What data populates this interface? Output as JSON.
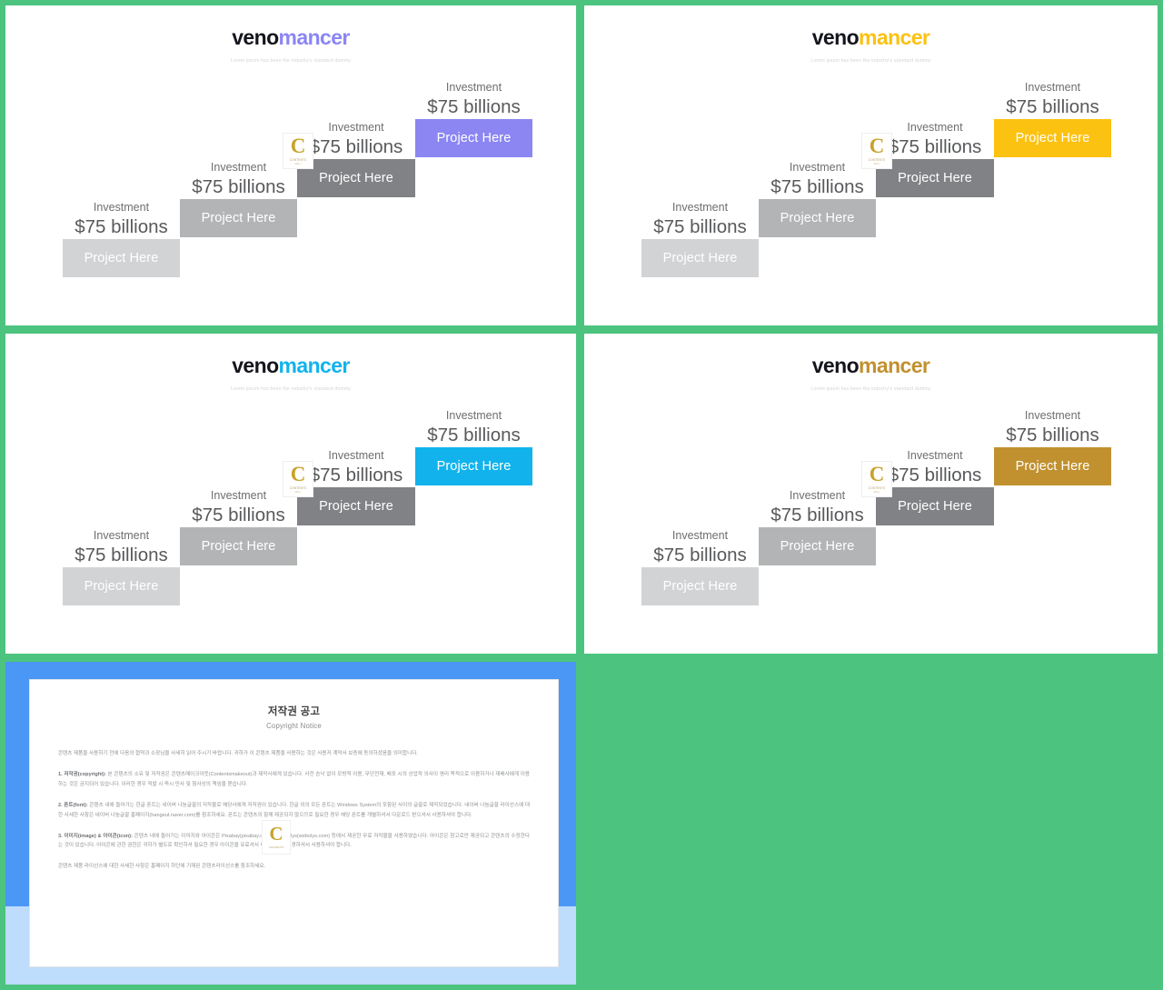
{
  "brand": {
    "name_part_a": "veno",
    "name_part_b": "mancer",
    "tagline": "Lorem ipsum has been the industry's standard dummy"
  },
  "watermark": {
    "letter": "C",
    "sub": "CONTENTS",
    "sub2": "MALL"
  },
  "step_defaults": {
    "investment_label": "Investment",
    "investment_value": "$75 billions",
    "bar_label": "Project Here"
  },
  "slides": [
    {
      "id": "slide-1",
      "accent_color": "#8b86f2",
      "logo_accent": "#8b86f2",
      "steps": [
        {
          "label": "Investment",
          "value": "$75 billions",
          "bar": "Project Here",
          "color": "#d2d3d5"
        },
        {
          "label": "Investment",
          "value": "$75 billions",
          "bar": "Project Here",
          "color": "#b3b4b6"
        },
        {
          "label": "Investment",
          "value": "$75 billions",
          "bar": "Project Here",
          "color": "#808285"
        },
        {
          "label": "Investment",
          "value": "$75 billions",
          "bar": "Project Here",
          "color": "#8b86f2"
        }
      ]
    },
    {
      "id": "slide-2",
      "accent_color": "#fcc211",
      "logo_accent": "#fcc211",
      "steps": [
        {
          "label": "Investment",
          "value": "$75 billions",
          "bar": "Project Here",
          "color": "#d2d3d5"
        },
        {
          "label": "Investment",
          "value": "$75 billions",
          "bar": "Project Here",
          "color": "#b3b4b6"
        },
        {
          "label": "Investment",
          "value": "$75 billions",
          "bar": "Project Here",
          "color": "#808285"
        },
        {
          "label": "Investment",
          "value": "$75 billions",
          "bar": "Project Here",
          "color": "#fcc211"
        }
      ]
    },
    {
      "id": "slide-3",
      "accent_color": "#12b3ec",
      "logo_accent": "#12b3ec",
      "steps": [
        {
          "label": "Investment",
          "value": "$75 billions",
          "bar": "Project Here",
          "color": "#d2d3d5"
        },
        {
          "label": "Investment",
          "value": "$75 billions",
          "bar": "Project Here",
          "color": "#b3b4b6"
        },
        {
          "label": "Investment",
          "value": "$75 billions",
          "bar": "Project Here",
          "color": "#808285"
        },
        {
          "label": "Investment",
          "value": "$75 billions",
          "bar": "Project Here",
          "color": "#12b3ec"
        }
      ]
    },
    {
      "id": "slide-4",
      "accent_color": "#c1912f",
      "logo_accent": "#c1912f",
      "steps": [
        {
          "label": "Investment",
          "value": "$75 billions",
          "bar": "Project Here",
          "color": "#d2d3d5"
        },
        {
          "label": "Investment",
          "value": "$75 billions",
          "bar": "Project Here",
          "color": "#b3b4b6"
        },
        {
          "label": "Investment",
          "value": "$75 billions",
          "bar": "Project Here",
          "color": "#808285"
        },
        {
          "label": "Investment",
          "value": "$75 billions",
          "bar": "Project Here",
          "color": "#c1912f"
        }
      ]
    }
  ],
  "copyright_notice": {
    "title": "저작권 공고",
    "subtitle": "Copyright Notice",
    "paragraphs": [
      {
        "lead": "",
        "text": "콘텐츠 제품을 사용하기 전에 다음의 협약과 소장님을 사세히 읽어 주시기 바랍니다. 귀하가 이 콘텐츠 제품을 사용하는 것은 사용자 계약서 보증에 동의하셨음을 의미합니다."
      },
      {
        "lead": "1. 저작권(copyright):",
        "text": " 본 콘텐츠의 소유 및 저작권은 콘텐츠메이크아웃(Contentsmakeout)과 제작사에게 있습니다. 사전 승낙 없이 모방적 이용, 무단전재, 배포 시의 상업적 의사이 영리 목적으로 이용하거나 재배사에게 이용하는 것은 금지되어 있습니다. 이러한 경우 적발 시 즉시 민사 및 형사상의 책임을 묻습니다."
      },
      {
        "lead": "2. 폰트(font):",
        "text": " 콘텐츠 내에 들어가는 한글 폰트는 네이버 나눔글꼴의 저작물로 해당사에게 저작권이 있습니다. 한글 외의 모든 폰트는 Windows System의 포함된 사이의 글꼴로 제작되었습니다. 네이버 나눔글꼴 라이선스에 대한 사세한 사항은 네이버 나눔글꼴 홈페이지(hangeul.naver.com)를 참조하세요. 폰트는 콘텐츠의 함께 제공되지 않으므로 필요한 경우 해당 폰트를 개별하셔서 다운로드 받으셔서 사용하셔야 합니다."
      },
      {
        "lead": "3. 이미지(image) & 아이콘(icon):",
        "text": " 콘텐츠 내에 들어가는 이미지와 아이콘은 Pixabay(pixabay.com)와 Webolys(webolys.com) 등에서 제공한 무료 저작물을 사용하였습니다. 아이콘은 참고로만 제공되고 콘텐츠의 수정한다는 것이 있습니다. 아이콘에 관한 권한은 귀하가 별도로 확인하셔 필요한 경우 아이콘을 유료셔서 더 아이콘을 변경하셔서 사용하셔야 합니다."
      },
      {
        "lead": "",
        "text": "콘텐츠 제품 라이선스에 대한 사세한 사항은 홈페이지 하단에 기재된 콘텐츠라이선스를 참조하세요."
      }
    ]
  }
}
